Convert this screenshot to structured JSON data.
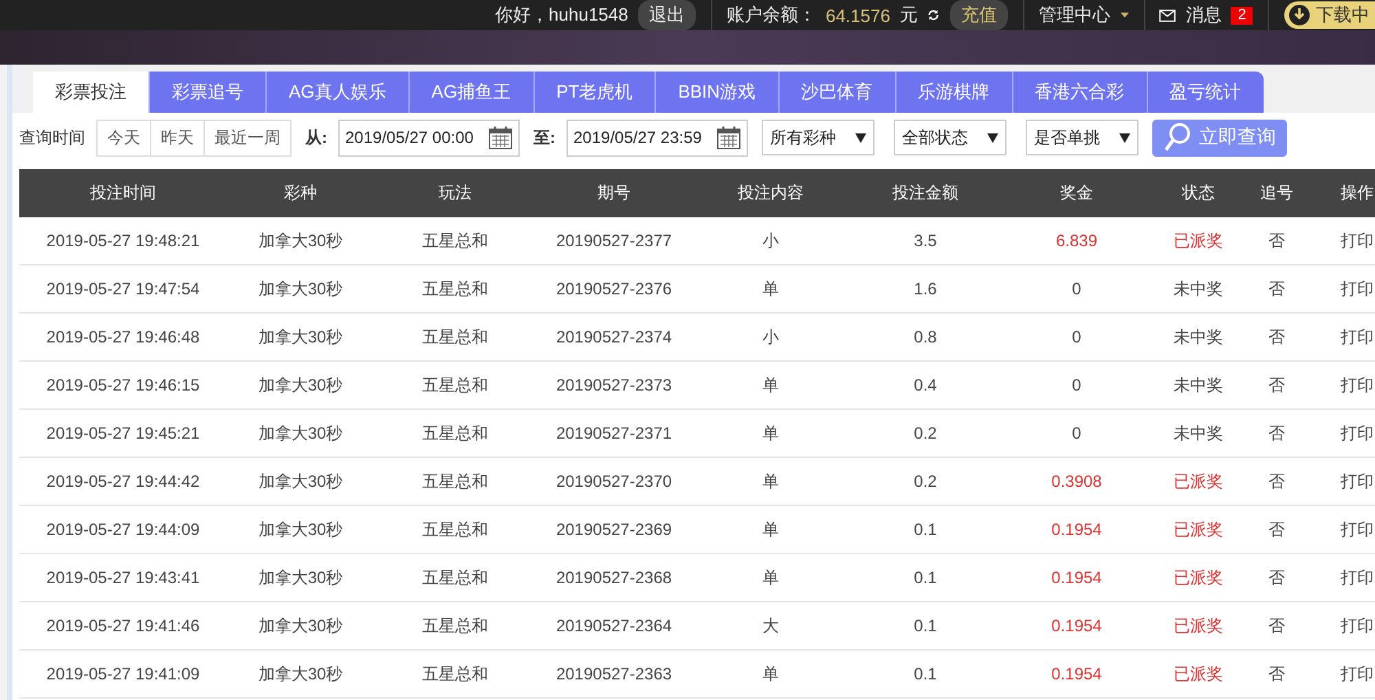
{
  "top_bar": {
    "greeting": "你好，huhu1548",
    "logout": "退出",
    "balance_label": "账户余额：",
    "balance": "64.1576",
    "currency": "元",
    "recharge": "充值",
    "manage": "管理中心",
    "messages": "消息",
    "message_count": "2",
    "download": "下载中"
  },
  "tabs": [
    {
      "label": "彩票投注",
      "selected": true
    },
    {
      "label": "彩票追号",
      "selected": false
    },
    {
      "label": "AG真人娱乐",
      "selected": false
    },
    {
      "label": "AG捕鱼王",
      "selected": false
    },
    {
      "label": "PT老虎机",
      "selected": false
    },
    {
      "label": "BBIN游戏",
      "selected": false
    },
    {
      "label": "沙巴体育",
      "selected": false
    },
    {
      "label": "乐游棋牌",
      "selected": false
    },
    {
      "label": "香港六合彩",
      "selected": false
    },
    {
      "label": "盈亏统计",
      "selected": false
    }
  ],
  "filters": {
    "time_label": "查询时间",
    "quick_ranges": [
      {
        "label": "今天",
        "selected": false
      },
      {
        "label": "昨天",
        "selected": false
      },
      {
        "label": "最近一周",
        "selected": false
      }
    ],
    "from_label": "从:",
    "from": "2019/05/27 00:00",
    "to_label": "至:",
    "to": "2019/05/27 23:59",
    "selects": [
      "所有彩种",
      "全部状态",
      "是否单挑"
    ],
    "search_button": "立即查询"
  },
  "table": {
    "columns": [
      "投注时间",
      "彩种",
      "玩法",
      "期号",
      "投注内容",
      "投注金额",
      "奖金",
      "状态",
      "追号",
      "操作"
    ],
    "rows": [
      {
        "won": true,
        "cells": [
          "2019-05-27 19:48:21",
          "加拿大30秒",
          "五星总和",
          "20190527-2377",
          "小",
          "3.5",
          "6.839",
          "已派奖",
          "否",
          "打印"
        ]
      },
      {
        "won": false,
        "cells": [
          "2019-05-27 19:47:54",
          "加拿大30秒",
          "五星总和",
          "20190527-2376",
          "单",
          "1.6",
          "0",
          "未中奖",
          "否",
          "打印"
        ]
      },
      {
        "won": false,
        "cells": [
          "2019-05-27 19:46:48",
          "加拿大30秒",
          "五星总和",
          "20190527-2374",
          "小",
          "0.8",
          "0",
          "未中奖",
          "否",
          "打印"
        ]
      },
      {
        "won": false,
        "cells": [
          "2019-05-27 19:46:15",
          "加拿大30秒",
          "五星总和",
          "20190527-2373",
          "单",
          "0.4",
          "0",
          "未中奖",
          "否",
          "打印"
        ]
      },
      {
        "won": false,
        "cells": [
          "2019-05-27 19:45:21",
          "加拿大30秒",
          "五星总和",
          "20190527-2371",
          "单",
          "0.2",
          "0",
          "未中奖",
          "否",
          "打印"
        ]
      },
      {
        "won": true,
        "cells": [
          "2019-05-27 19:44:42",
          "加拿大30秒",
          "五星总和",
          "20190527-2370",
          "单",
          "0.2",
          "0.3908",
          "已派奖",
          "否",
          "打印"
        ]
      },
      {
        "won": true,
        "cells": [
          "2019-05-27 19:44:09",
          "加拿大30秒",
          "五星总和",
          "20190527-2369",
          "单",
          "0.1",
          "0.1954",
          "已派奖",
          "否",
          "打印"
        ]
      },
      {
        "won": true,
        "cells": [
          "2019-05-27 19:43:41",
          "加拿大30秒",
          "五星总和",
          "20190527-2368",
          "单",
          "0.1",
          "0.1954",
          "已派奖",
          "否",
          "打印"
        ]
      },
      {
        "won": true,
        "cells": [
          "2019-05-27 19:41:46",
          "加拿大30秒",
          "五星总和",
          "20190527-2364",
          "大",
          "0.1",
          "0.1954",
          "已派奖",
          "否",
          "打印"
        ]
      },
      {
        "won": true,
        "cells": [
          "2019-05-27 19:41:09",
          "加拿大30秒",
          "五星总和",
          "20190527-2363",
          "单",
          "0.1",
          "0.1954",
          "已派奖",
          "否",
          "打印"
        ]
      }
    ]
  }
}
